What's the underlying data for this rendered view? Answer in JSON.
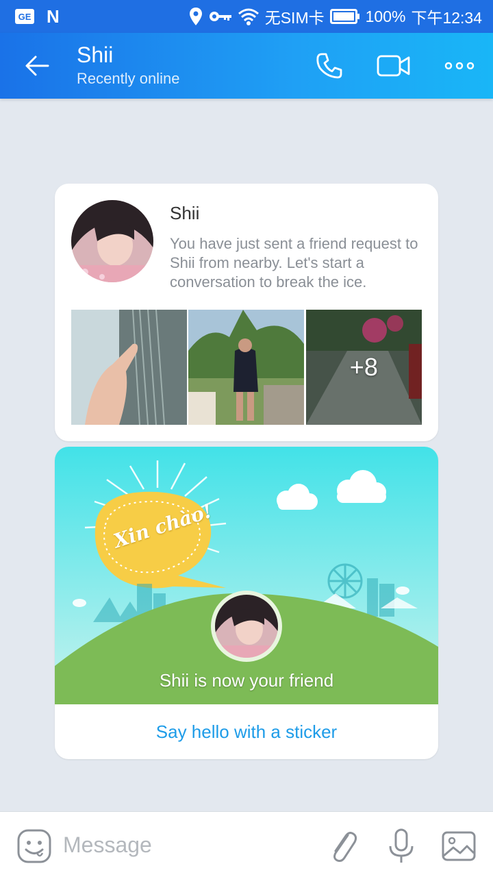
{
  "status_bar": {
    "badge": "GE",
    "n_icon_glyph": "N",
    "sim_status": "无SIM卡",
    "battery": "100%",
    "time": "下午12:34",
    "icons": [
      "location-icon",
      "key-icon",
      "wifi-icon",
      "battery-icon"
    ]
  },
  "header": {
    "name": "Shii",
    "status": "Recently online",
    "icons": [
      "back-arrow-icon",
      "phone-icon",
      "video-camera-icon",
      "more-dots-icon"
    ]
  },
  "intro_card": {
    "name": "Shii",
    "text": "You have just sent a friend request to Shii from nearby. Let's start a conversation to break the ice.",
    "more_photos": "+8"
  },
  "friend_card": {
    "bubble_text": "Xin chào!",
    "friend_text": "Shii is now your friend",
    "sticker_link": "Say hello with a sticker"
  },
  "composer": {
    "placeholder": "Message",
    "icons": [
      "emoji-icon",
      "paperclip-icon",
      "microphone-icon",
      "image-icon"
    ]
  },
  "colors": {
    "header_start": "#1a72e8",
    "header_end": "#19b6f7",
    "link": "#1e9ce8",
    "background": "#e3e8ef"
  }
}
